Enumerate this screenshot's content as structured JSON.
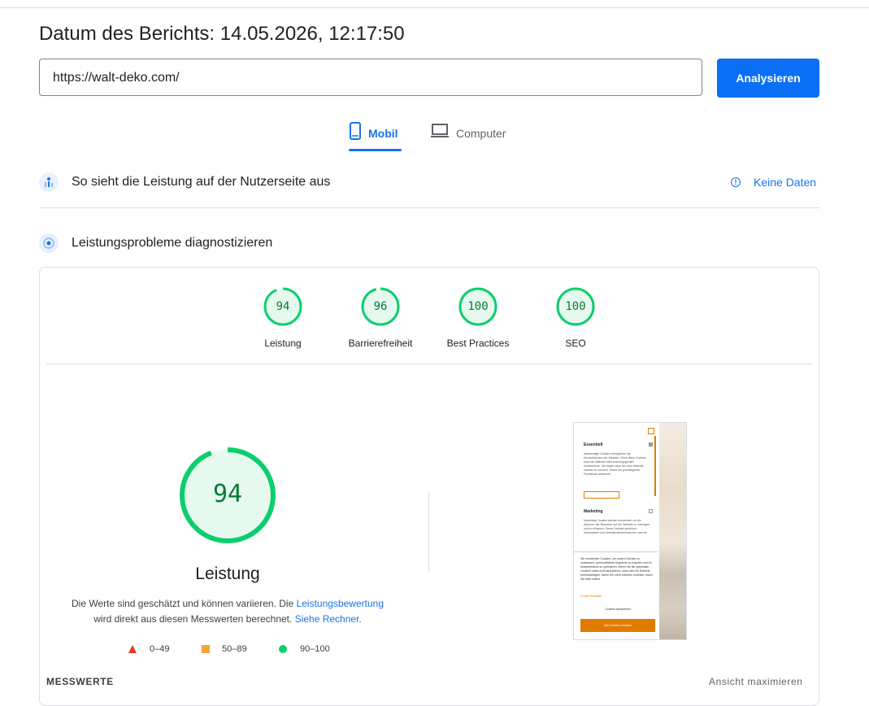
{
  "report": {
    "date_label": "Datum des Berichts: 14.05.2026, 12:17:50"
  },
  "search": {
    "url_value": "https://walt-deko.com/",
    "analyze_label": "Analysieren"
  },
  "tabs": [
    {
      "label": "Mobil",
      "active": true,
      "icon": "phone-icon"
    },
    {
      "label": "Computer",
      "active": false,
      "icon": "laptop-icon"
    }
  ],
  "field_data": {
    "title": "So sieht die Leistung auf der Nutzerseite aus",
    "status": "Keine Daten"
  },
  "diagnose": {
    "title": "Leistungsprobleme diagnostizieren"
  },
  "scores": [
    {
      "value": 94,
      "label": "Leistung"
    },
    {
      "value": 96,
      "label": "Barrierefreiheit"
    },
    {
      "value": 100,
      "label": "Best Practices"
    },
    {
      "value": 100,
      "label": "SEO"
    }
  ],
  "performance": {
    "score": 94,
    "title": "Leistung",
    "desc_1": "Die Werte sind geschätzt und können variieren. Die ",
    "desc_link_1": "Leistungsbewertung",
    "desc_2": "wird direkt aus diesen Messwerten berechnet. ",
    "desc_link_2": "Siehe Rechner",
    "desc_3": "."
  },
  "legend": [
    {
      "range": "0–49",
      "color": "#e8362d",
      "icon": "triangle-icon"
    },
    {
      "range": "50–89",
      "color": "#f2a33a",
      "icon": "square-icon"
    },
    {
      "range": "90–100",
      "color": "#0cce6b",
      "icon": "circle-icon"
    }
  ],
  "screenshot": {
    "heading_1": "Essentiell",
    "text_1": "Notwendige Cookies ermöglichen die Kernfunktionen der Website. Ohne diese Cookies kann die Website nicht ordnungsgemäß funktionieren. Sie liegen dazu bei, eine Website nutzbar zu machen, indem sie grundlegende Funktionen aktivieren.",
    "heading_2": "Marketing",
    "text_2": "Marketing Cookies werden verwendet, um die Aktionen der Besucher auf der Website zu verfolgen und zu erfassen. Diese Cookies speichern Nutzerdaten und Verhaltensinformationen, was es",
    "text_3": "Wir verwenden Cookies, um unsere Dienste zu verbessern, personalisierte Angebote zu machen und Ihr Nutzererlebnis zu optimieren. Wenn Sie die optionalen Cookies unten nicht akzeptieren, kann dies Ihr Erlebnis beeinträchtigen. Wenn Sie mehr erfahren möchten, lesen Sie bitte unsere",
    "link": "Cookie-Richtlinie",
    "accept_label": "Cookies akzeptieren",
    "accept_all_label": "Alle Cookies zulassen",
    "accent": "#e07b00"
  },
  "footer": {
    "metrics_label": "MESSWERTE",
    "maximize_label": "Ansicht maximieren"
  },
  "colors": {
    "accent": "#1a73e8",
    "good": "#0cce6b",
    "good_text": "#0c7a36",
    "good_fill": "#e6f9ee"
  }
}
